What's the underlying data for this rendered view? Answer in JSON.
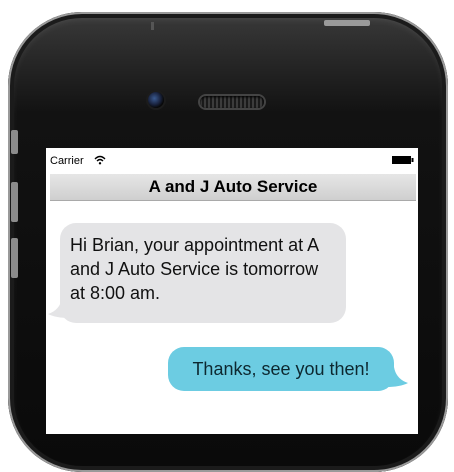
{
  "status_bar": {
    "carrier": "Carrier",
    "wifi_icon": "wifi-icon",
    "battery_icon": "battery-icon"
  },
  "nav": {
    "title": "A and J Auto Service"
  },
  "messages": [
    {
      "direction": "incoming",
      "text": "Hi Brian, your appointment at A and J Auto Service is tomorrow at 8:00 am.",
      "color": "#e4e4e6"
    },
    {
      "direction": "outgoing",
      "text": "Thanks, see you then!",
      "color": "#6ccce2"
    }
  ],
  "device": {
    "body_color": "#111111",
    "camera_icon": "camera-icon",
    "speaker_icon": "speaker-grille-icon"
  }
}
